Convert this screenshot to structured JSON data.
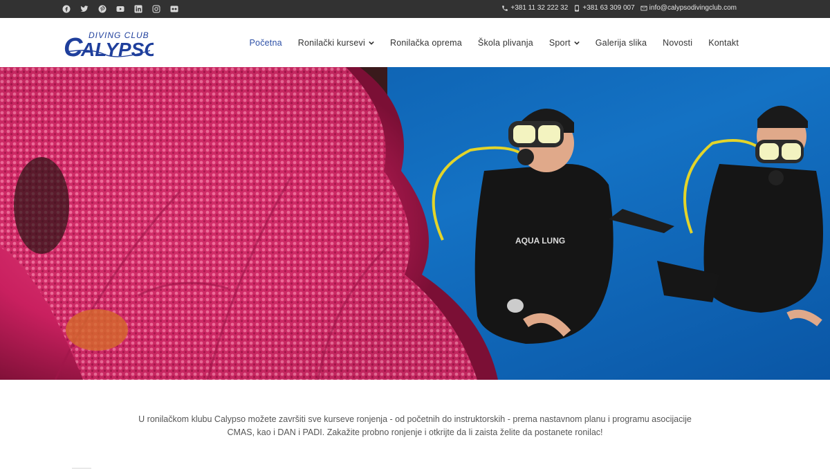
{
  "topbar": {
    "social_icons": [
      "facebook-icon",
      "twitter-icon",
      "pinterest-icon",
      "youtube-icon",
      "linkedin-icon",
      "instagram-icon",
      "flickr-icon"
    ],
    "phone1": "+381 11 32 222 32",
    "phone2": "+381 63 309 007",
    "email": "info@calypsodivingclub.com"
  },
  "logo": {
    "top_text": "DIVING CLUB",
    "main_text": "ALYPSO",
    "initial": "C",
    "brand_color": "#1f3f9c"
  },
  "nav": {
    "items": [
      {
        "label": "Početna",
        "active": true,
        "dropdown": false
      },
      {
        "label": "Ronilački kursevi",
        "active": false,
        "dropdown": true
      },
      {
        "label": "Ronilačka oprema",
        "active": false,
        "dropdown": false
      },
      {
        "label": "Škola plivanja",
        "active": false,
        "dropdown": false
      },
      {
        "label": "Sport",
        "active": false,
        "dropdown": true
      },
      {
        "label": "Galerija slika",
        "active": false,
        "dropdown": false
      },
      {
        "label": "Novosti",
        "active": false,
        "dropdown": false
      },
      {
        "label": "Kontakt",
        "active": false,
        "dropdown": false
      }
    ],
    "active_color": "#2c4fa6"
  },
  "intro": {
    "line1": "U ronilačkom klubu Calypso možete završiti sve kurseve ronjenja - od početnih do instruktorskih - prema nastavnom planu i programu asocijacije",
    "line2": "CMAS, kao i DAN i PADI. Zakažite probno ronjenje i otkrijte da li zaista želite da postanete ronilac!"
  },
  "hero": {
    "description_icon": "divers-coral-photo",
    "water_color": "#1069b8",
    "coral_color": "#d6306f"
  }
}
